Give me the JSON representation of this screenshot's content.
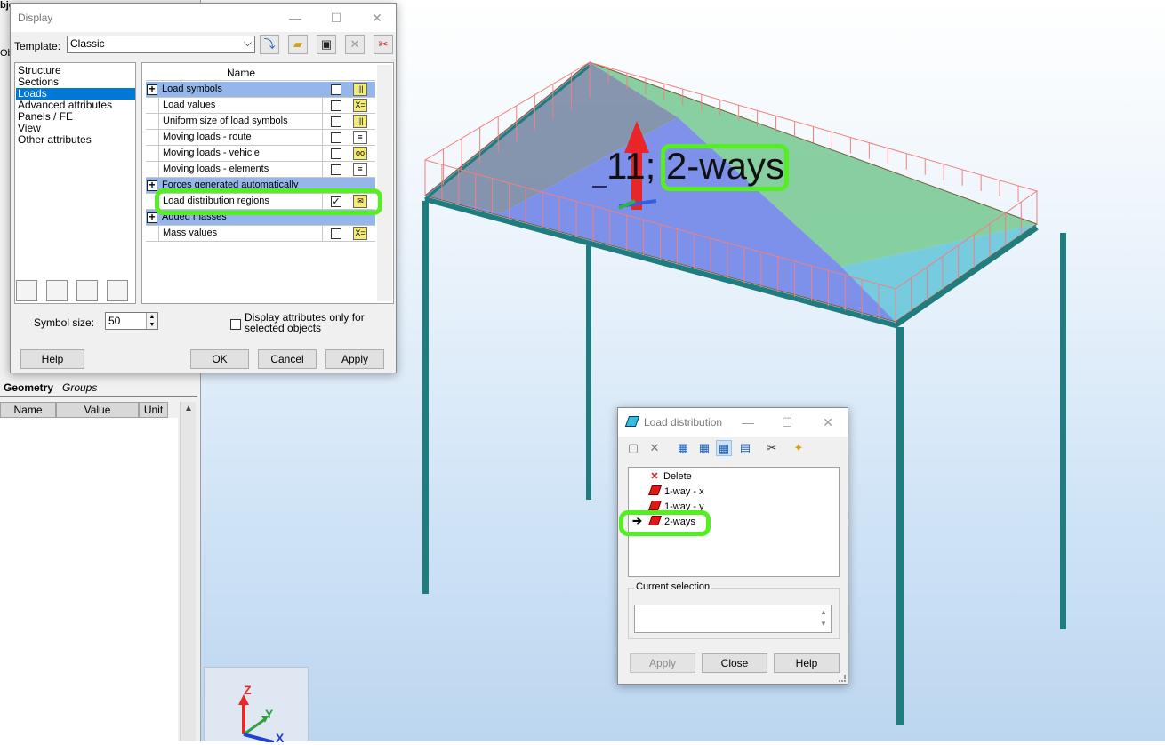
{
  "left_panel": {
    "header": "bje",
    "side_text": "Ob",
    "tabs": [
      "Geometry",
      "Groups"
    ],
    "grid_columns": [
      "Name",
      "Value",
      "Unit"
    ]
  },
  "viewport": {
    "node_label_prefix": "11;",
    "node_label_value": "2-ways",
    "axes": {
      "z": "Z",
      "y": "Y",
      "x": "X"
    },
    "colors": {
      "frame": "#1f7d80",
      "load_lines": "#f08080",
      "slab_blue": "#6a7fe6",
      "slab_green": "#74c890",
      "highlight": "#55ee22"
    }
  },
  "display_dialog": {
    "title": "Display",
    "template_label": "Template:",
    "template_value": "Classic",
    "toolbar_icons": [
      "apply-template-icon",
      "open-folder-icon",
      "save-icon",
      "delete-icon",
      "reset-icon"
    ],
    "categories": [
      "Structure",
      "Sections",
      "Loads",
      "Advanced attributes",
      "Panels / FE",
      "View",
      "Other attributes"
    ],
    "selected_category": "Loads",
    "attr_column_header": "Name",
    "attributes": [
      {
        "label": "Load symbols",
        "group": true,
        "checked": false
      },
      {
        "label": "Load values",
        "group": false,
        "checked": false
      },
      {
        "label": "Uniform size of load symbols",
        "group": false,
        "checked": false
      },
      {
        "label": "Moving loads - route",
        "group": false,
        "checked": false
      },
      {
        "label": "Moving loads - vehicle",
        "group": false,
        "checked": false
      },
      {
        "label": "Moving loads - elements",
        "group": false,
        "checked": false
      },
      {
        "label": "Forces generated automatically",
        "group": true,
        "checked": false
      },
      {
        "label": "Load distribution regions",
        "group": false,
        "checked": true
      },
      {
        "label": "Added masses",
        "group": true,
        "checked": false
      },
      {
        "label": "Mass values",
        "group": false,
        "checked": false
      }
    ],
    "symbol_size_label": "Symbol size:",
    "symbol_size_value": "50",
    "only_selected_label_line1": "Display attributes only for",
    "only_selected_label_line2": "selected objects",
    "buttons": {
      "help": "Help",
      "ok": "OK",
      "cancel": "Cancel",
      "apply": "Apply"
    }
  },
  "ld_dialog": {
    "title": "Load distribution",
    "items": [
      {
        "label": "Delete",
        "icon": "delete-x-icon"
      },
      {
        "label": "1-way - x",
        "icon": "region-icon"
      },
      {
        "label": "1-way - y",
        "icon": "region-icon"
      },
      {
        "label": "2-ways",
        "icon": "region-icon",
        "current": true
      }
    ],
    "current_selection_label": "Current selection",
    "current_selection_value": "",
    "buttons": {
      "apply": "Apply",
      "close": "Close",
      "help": "Help"
    }
  }
}
